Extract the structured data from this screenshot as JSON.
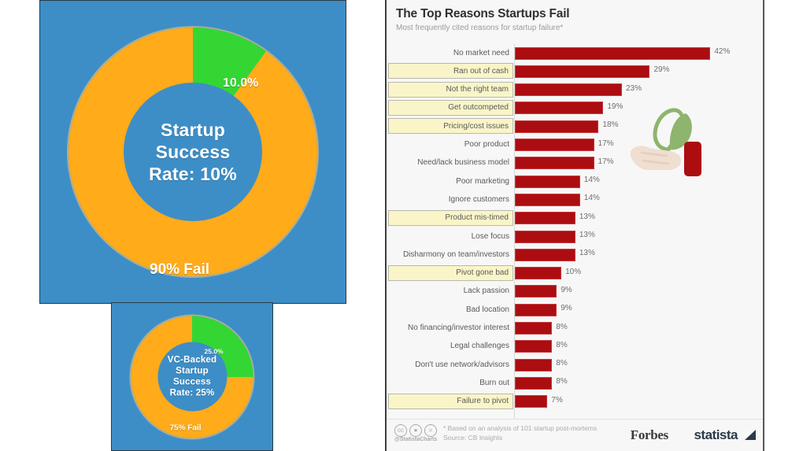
{
  "left_panel": {
    "main_donut": {
      "center_text": "Startup\nSuccess\nRate: 10%",
      "success_label": "10.0%",
      "fail_label": "90% Fail"
    },
    "vc_donut": {
      "center_text": "VC-Backed\nStartup\nSuccess\nRate: 25%",
      "success_label": "25.0%",
      "fail_label": "75% Fail"
    }
  },
  "chart": {
    "title": "The Top Reasons Startups Fail",
    "subtitle": "Most frequently cited reasons for startup failure*",
    "footnote_1": "* Based on an analysis of 101 startup post-mortems",
    "footnote_2": "Source: CB Insights",
    "handle": "@StatistaCharts",
    "brand_forbes": "Forbes",
    "brand_statista": "statista",
    "cc_icons": [
      "cc-icon",
      "cc-by-icon",
      "cc-nd-icon"
    ],
    "illustration": "hand-holding-plant-icon"
  },
  "chart_data": [
    {
      "type": "bar",
      "orientation": "horizontal",
      "title": "The Top Reasons Startups Fail",
      "subtitle": "Most frequently cited reasons for startup failure*",
      "xlabel": "",
      "ylabel": "",
      "xlim": [
        0,
        46
      ],
      "grid": false,
      "legend": "none",
      "bar_color": "#ab0d11",
      "highlight_color": "#f9f5c8",
      "value_suffix": "%",
      "categories": [
        "No market need",
        "Ran out of cash",
        "Not the right team",
        "Get outcompeted",
        "Pricing/cost issues",
        "Poor product",
        "Need/lack business model",
        "Poor marketing",
        "Ignore customers",
        "Product mis-timed",
        "Lose focus",
        "Disharmony on team/investors",
        "Pivot gone bad",
        "Lack passion",
        "Bad location",
        "No financing/investor interest",
        "Legal challenges",
        "Don't use network/advisors",
        "Burn out",
        "Failure to pivot"
      ],
      "values": [
        42,
        29,
        23,
        19,
        18,
        17,
        17,
        14,
        14,
        13,
        13,
        13,
        10,
        9,
        9,
        8,
        8,
        8,
        8,
        7
      ],
      "value_labels": [
        "42%",
        "29%",
        "23%",
        "19%",
        "18%",
        "17%",
        "17%",
        "14%",
        "14%",
        "13%",
        "13%",
        "13%",
        "10%",
        "9%",
        "9%",
        "8%",
        "8%",
        "8%",
        "8%",
        "7%"
      ],
      "highlighted": [
        false,
        true,
        true,
        true,
        true,
        false,
        false,
        false,
        false,
        true,
        false,
        false,
        true,
        false,
        false,
        false,
        false,
        false,
        false,
        true
      ]
    },
    {
      "type": "pie",
      "variant": "donut",
      "title": "Startup Success Rate: 10%",
      "labels": [
        "Success",
        "Fail"
      ],
      "values": [
        10,
        90
      ],
      "value_labels": [
        "10.0%",
        "90% Fail"
      ],
      "colors": [
        "#33d633",
        "#ffab1a"
      ],
      "background": "#3d8ec7"
    },
    {
      "type": "pie",
      "variant": "donut",
      "title": "VC-Backed Startup Success Rate: 25%",
      "labels": [
        "Success",
        "Fail"
      ],
      "values": [
        25,
        75
      ],
      "value_labels": [
        "25.0%",
        "75% Fail"
      ],
      "colors": [
        "#33d633",
        "#ffab1a"
      ],
      "background": "#3d8ec7"
    }
  ]
}
